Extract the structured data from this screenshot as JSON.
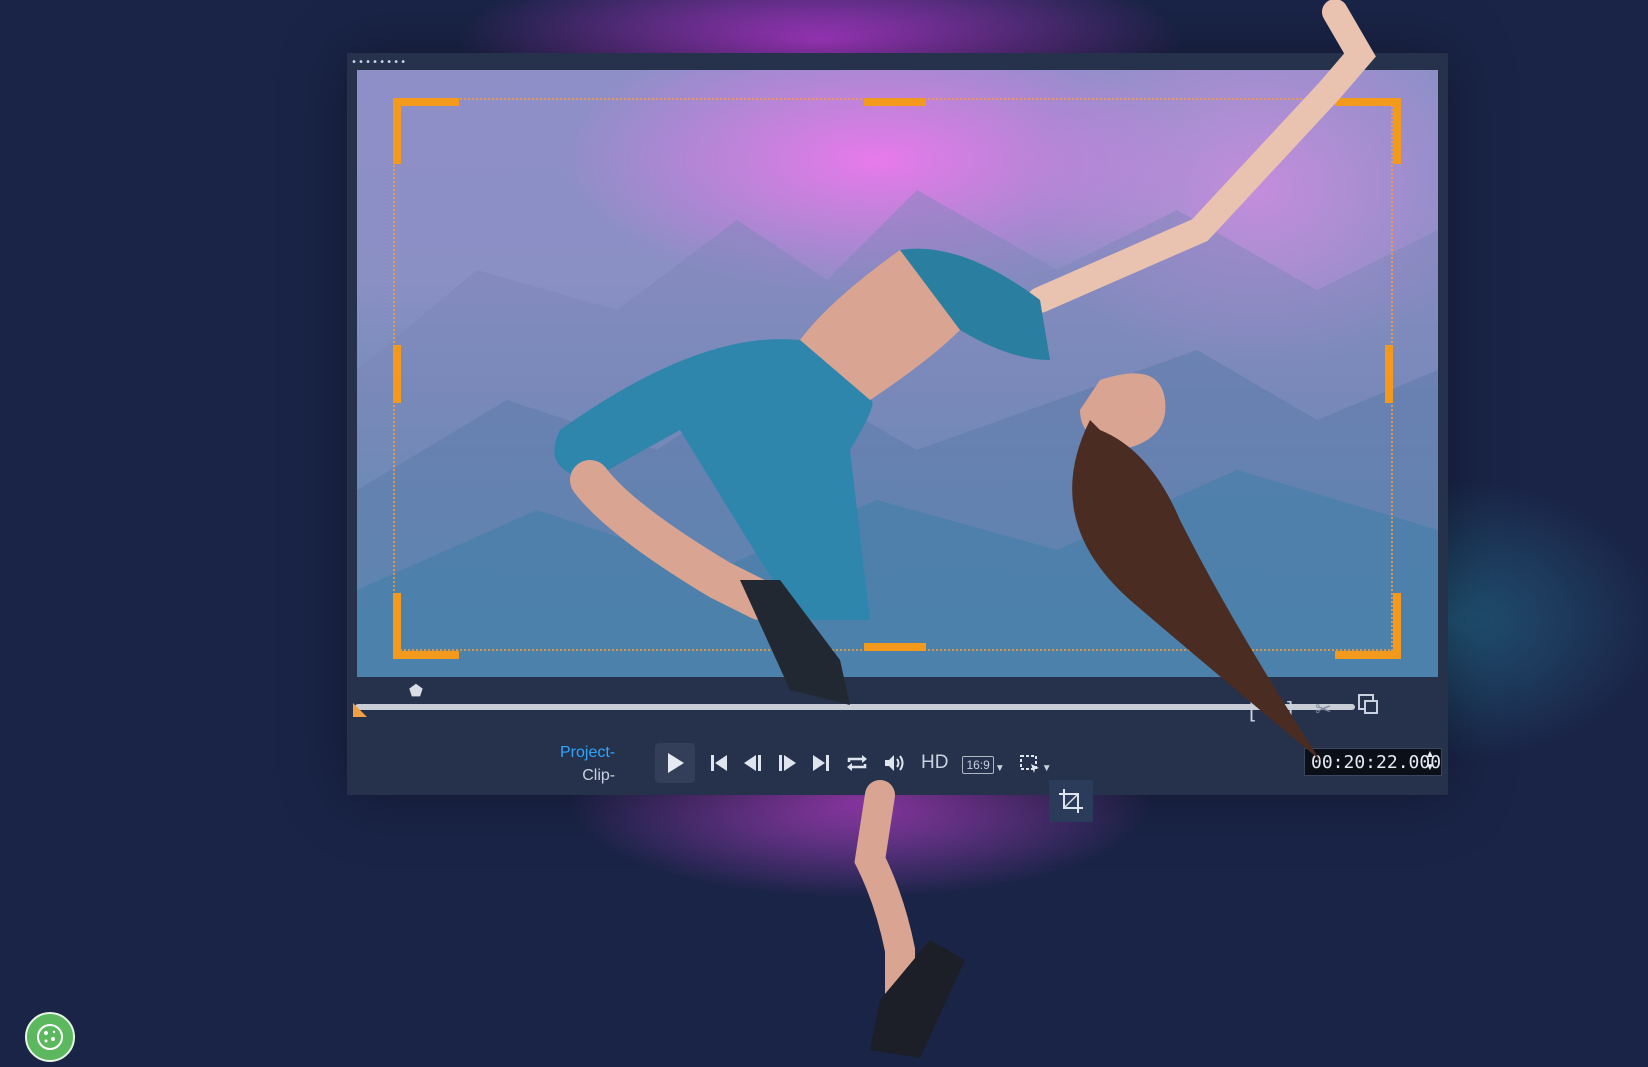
{
  "player": {
    "grip_label": "••••••••",
    "mode_project": "Project-",
    "mode_clip": "Clip-",
    "hd_label": "HD",
    "aspect_ratio": "16:9",
    "timecode": "00:20:22.000",
    "mark_in": "[",
    "mark_out": "]",
    "scrubber_glyph": "⬟"
  },
  "icons": {
    "play": "play-icon",
    "start": "skip-to-start-icon",
    "prev_frame": "previous-frame-icon",
    "next_frame": "next-frame-icon",
    "end": "skip-to-end-icon",
    "repeat": "repeat-icon",
    "volume": "volume-icon",
    "crop": "crop-icon",
    "cookie": "cookie-icon"
  },
  "colors": {
    "crop_guide": "#f39a1c",
    "project_accent": "#2ea6ff",
    "background": "#1a2447",
    "glow": "#c03cdc",
    "cookie": "#5bb85e"
  }
}
